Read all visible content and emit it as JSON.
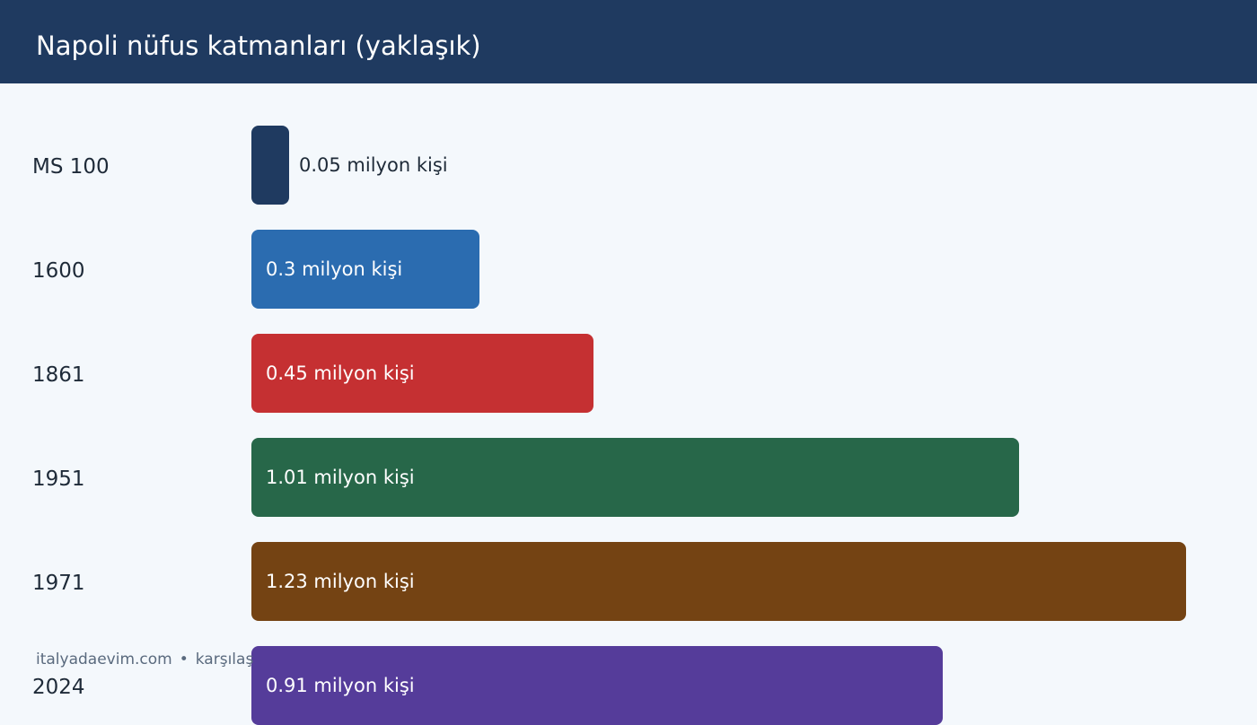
{
  "header": {
    "title": "Napoli nüfus katmanları (yaklaşık)"
  },
  "footer": {
    "site": "italyadaevim.com",
    "separator": "•",
    "note": "karşılaş"
  },
  "chart_data": {
    "type": "bar",
    "orientation": "horizontal",
    "title": "Napoli nüfus katmanları (yaklaşık)",
    "unit": "milyon kişi",
    "xlim": [
      0,
      1.23
    ],
    "categories": [
      "MS 100",
      "1600",
      "1861",
      "1951",
      "1971",
      "2024"
    ],
    "values": [
      0.05,
      0.3,
      0.45,
      1.01,
      1.23,
      0.91
    ],
    "labels": [
      "0.05 milyon kişi",
      "0.3 milyon kişi",
      "0.45 milyon kişi",
      "1.01 milyon kişi",
      "1.23 milyon kişi",
      "0.91 milyon kişi"
    ],
    "colors": [
      "#1f3a60",
      "#2b6cb0",
      "#c53032",
      "#276749",
      "#744313",
      "#553c9a"
    ]
  }
}
